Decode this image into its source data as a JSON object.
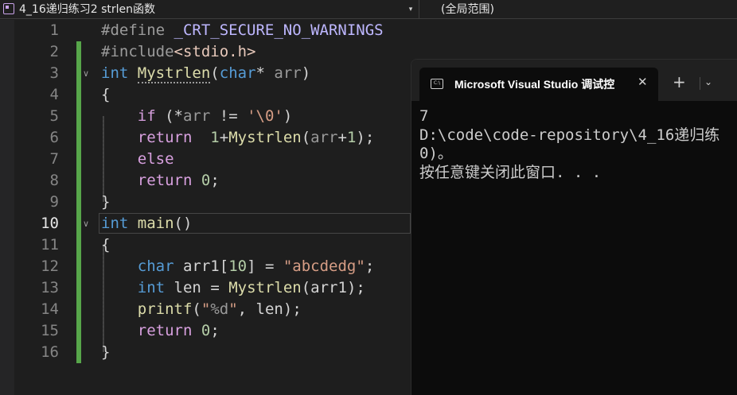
{
  "topbar": {
    "project": "4_16递归练习2 strlen函数",
    "scope": "(全局范围)",
    "dropdown_glyph": "▾"
  },
  "editor": {
    "current_line": 10,
    "lines": [
      {
        "n": "1"
      },
      {
        "n": "2"
      },
      {
        "n": "3"
      },
      {
        "n": "4"
      },
      {
        "n": "5"
      },
      {
        "n": "6"
      },
      {
        "n": "7"
      },
      {
        "n": "8"
      },
      {
        "n": "9"
      },
      {
        "n": "10"
      },
      {
        "n": "11"
      },
      {
        "n": "12"
      },
      {
        "n": "13"
      },
      {
        "n": "14"
      },
      {
        "n": "15"
      },
      {
        "n": "16"
      }
    ],
    "code": {
      "l1_pp": "#define ",
      "l1_macro": "_CRT_SECURE_NO_WARNINGS",
      "l2_pp": "#include",
      "l2_header": "<stdio.h>",
      "l3_type": "int",
      "l3_fn": "Mystrlen",
      "l3_open": "(",
      "l3_ptype": "char",
      "l3_star": "* ",
      "l3_param": "arr",
      "l3_close": ")",
      "l4_brace": "{",
      "l5_if": "if",
      "l5_a": " (*",
      "l5_arr": "arr",
      "l5_b": " != ",
      "l5_lit": "'\\0'",
      "l5_c": ")",
      "l6_ret": "return",
      "l6_sp": "  ",
      "l6_one": "1",
      "l6_plus": "+",
      "l6_fn": "Mystrlen",
      "l6_open": "(",
      "l6_arr": "arr",
      "l6_plus2": "+",
      "l6_one2": "1",
      "l6_close": ");",
      "l7_else": "else",
      "l8_ret": "return",
      "l8_sp": " ",
      "l8_zero": "0",
      "l8_semi": ";",
      "l9_brace": "}",
      "l10_type": "int",
      "l10_fn": "main",
      "l10_parens": "()",
      "l11_brace": "{",
      "l12_type": "char",
      "l12_var": "arr1",
      "l12_open": "[",
      "l12_size": "10",
      "l12_mid": "] = ",
      "l12_str": "\"abcdedg\"",
      "l12_semi": ";",
      "l13_type": "int",
      "l13_var": "len",
      "l13_eq": " = ",
      "l13_fn": "Mystrlen",
      "l13_open": "(",
      "l13_arg": "arr1",
      "l13_close": ");",
      "l14_fn": "printf",
      "l14_open": "(",
      "l14_q1": "\"",
      "l14_fmt": "%d",
      "l14_q2": "\"",
      "l14_comma": ", ",
      "l14_arg": "len",
      "l14_close": ");",
      "l15_ret": "return",
      "l15_sp": " ",
      "l15_zero": "0",
      "l15_semi": ";",
      "l16_brace": "}"
    }
  },
  "console": {
    "title": "Microsoft Visual Studio 调试控",
    "icon_text": "C:\\",
    "close_glyph": "✕",
    "add_glyph": "+",
    "dropdown_glyph": "⌄",
    "output": [
      "7",
      "D:\\code\\code-repository\\4_16递归练",
      "0)。",
      "按任意键关闭此窗口. . ."
    ]
  },
  "colors": {
    "editor_bg": "#1e1e1e",
    "keyword": "#569cd6",
    "function": "#dcdcaa",
    "string": "#d69d85",
    "number": "#b5cea8",
    "control": "#d8a0df",
    "change_bar": "#57a64a",
    "console_bg": "#0c0c0c"
  }
}
